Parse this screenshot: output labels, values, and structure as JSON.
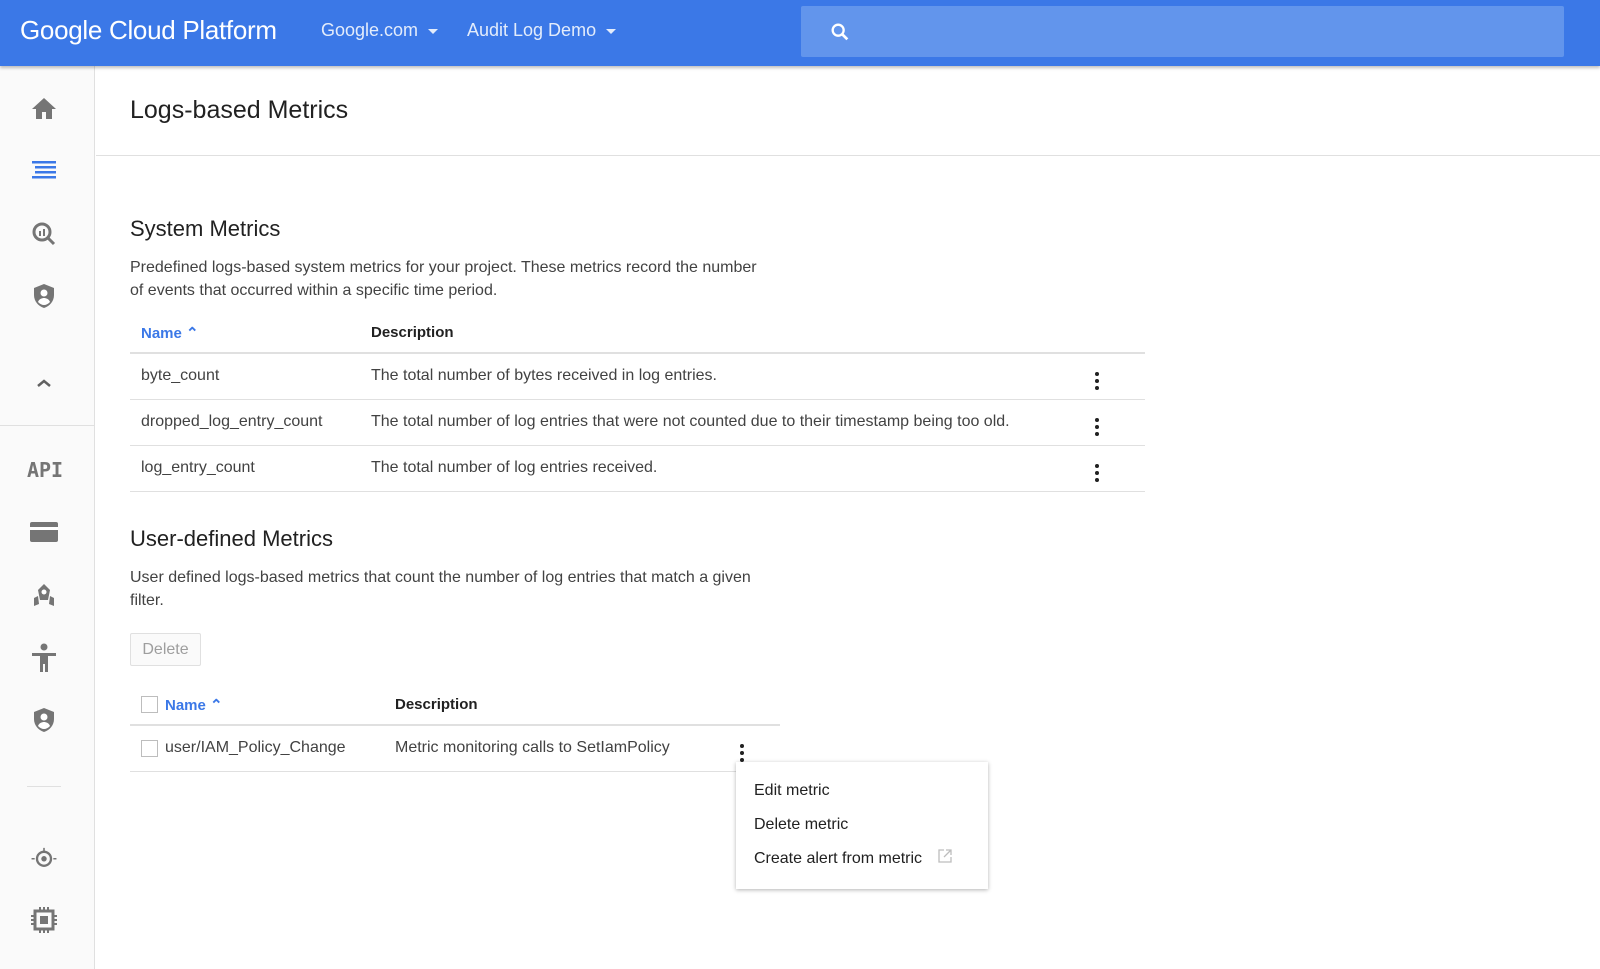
{
  "header": {
    "logo": "Google Cloud Platform",
    "org": "Google.com",
    "project": "Audit Log Demo",
    "search_placeholder": ""
  },
  "sidebar": {
    "items": [
      "home-icon",
      "logging-icon",
      "log-analytics-icon",
      "security-icon",
      "collapse-icon",
      "api-icon",
      "billing-icon",
      "deploy-icon",
      "iam-icon",
      "security-icon-2",
      "monitoring-icon",
      "compute-icon"
    ],
    "active_color": "#3b78e7"
  },
  "page": {
    "title": "Logs-based Metrics"
  },
  "system": {
    "title": "System Metrics",
    "description": "Predefined logs-based system metrics for your project. These metrics record the number of events that occurred within a specific time period.",
    "columns": {
      "name": "Name",
      "description": "Description"
    },
    "rows": [
      {
        "name": "byte_count",
        "description": "The total number of bytes received in log entries."
      },
      {
        "name": "dropped_log_entry_count",
        "description": "The total number of log entries that were not counted due to their timestamp being too old."
      },
      {
        "name": "log_entry_count",
        "description": "The total number of log entries received."
      }
    ]
  },
  "user": {
    "title": "User-defined Metrics",
    "description": "User defined logs-based metrics that count the number of log entries that match a given filter.",
    "delete_label": "Delete",
    "columns": {
      "name": "Name",
      "description": "Description"
    },
    "rows": [
      {
        "name": "user/IAM_Policy_Change",
        "description": "Metric monitoring calls to SetIamPolicy"
      }
    ]
  },
  "menu": {
    "items": [
      "Edit metric",
      "Delete metric",
      "Create alert from metric"
    ]
  }
}
